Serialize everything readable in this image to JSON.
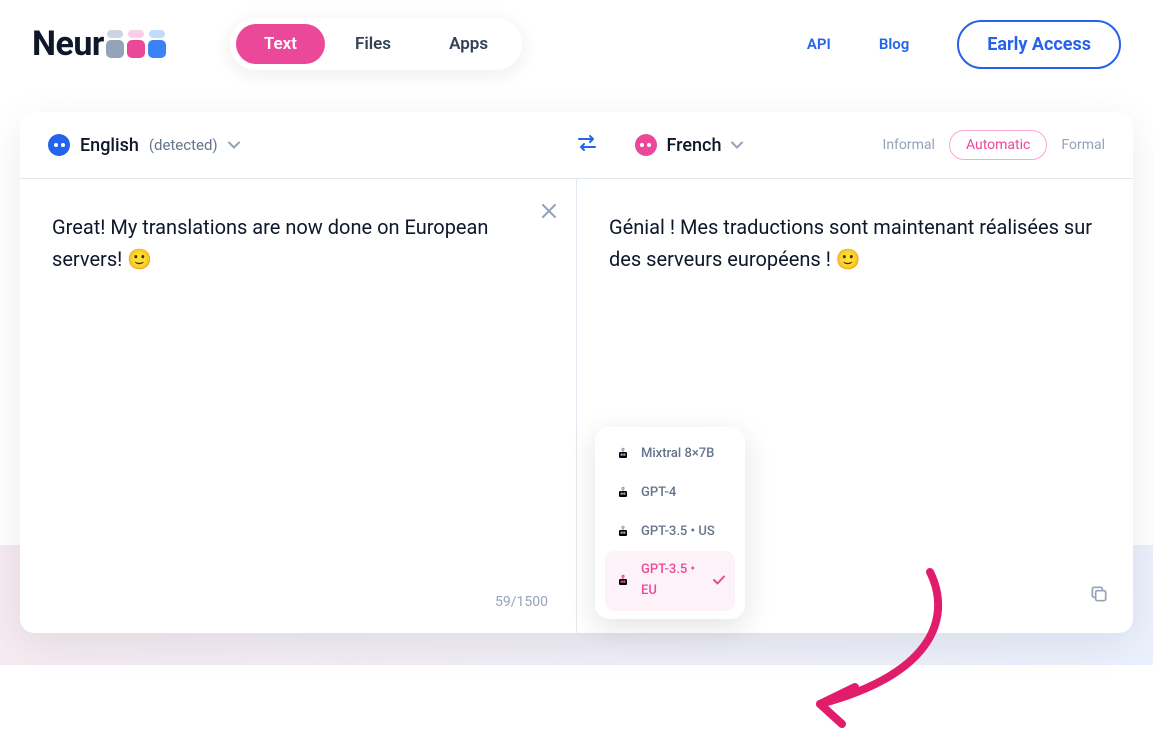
{
  "logo": {
    "text": "Neur"
  },
  "nav": {
    "pills": [
      {
        "label": "Text",
        "active": true
      },
      {
        "label": "Files",
        "active": false
      },
      {
        "label": "Apps",
        "active": false
      }
    ],
    "links": [
      {
        "label": "API"
      },
      {
        "label": "Blog"
      }
    ],
    "cta": "Early Access"
  },
  "source": {
    "language": "English",
    "detected": "(detected)",
    "text": "Great! My translations are now done on European servers! 🙂",
    "char_count": "59/1500"
  },
  "target": {
    "language": "French",
    "text": "Génial ! Mes traductions sont maintenant réalisées sur des serveurs européens ! 🙂"
  },
  "formality": {
    "options": [
      {
        "label": "Informal",
        "active": false
      },
      {
        "label": "Automatic",
        "active": true
      },
      {
        "label": "Formal",
        "active": false
      }
    ]
  },
  "models": [
    {
      "label": "Mixtral 8×7B",
      "selected": false
    },
    {
      "label": "GPT-4",
      "selected": false
    },
    {
      "label": "GPT-3.5 • US",
      "selected": false
    },
    {
      "label": "GPT-3.5 • EU",
      "selected": true
    }
  ],
  "colors": {
    "brand_blue": "#2563eb",
    "brand_pink": "#ec4899",
    "text": "#0f172a",
    "muted": "#94a3b8"
  }
}
